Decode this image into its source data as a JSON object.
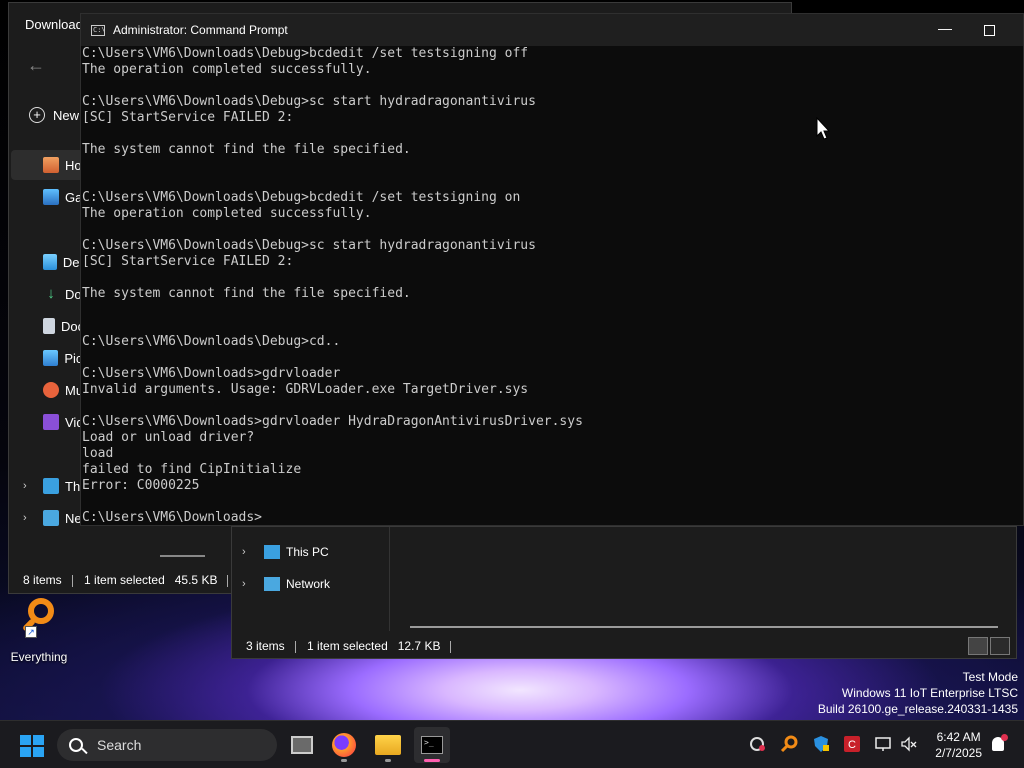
{
  "desktop": {
    "watermark": {
      "line1": "Test Mode",
      "line2": "Windows 11 IoT Enterprise LTSC",
      "line3": "Build 26100.ge_release.240331-1435"
    },
    "icons": [
      {
        "label": "Everything",
        "icon": "everything-search-icon"
      }
    ]
  },
  "explorer_back": {
    "tab_title": "Download",
    "new_label": "New",
    "nav_items": [
      {
        "label": "Ho",
        "icon": "home-icon"
      },
      {
        "label": "Gal",
        "icon": "gallery-icon"
      },
      {
        "label": "Des",
        "icon": "desktop-icon"
      },
      {
        "label": "Do",
        "icon": "downloads-icon"
      },
      {
        "label": "Doc",
        "icon": "documents-icon"
      },
      {
        "label": "Pict",
        "icon": "pictures-icon"
      },
      {
        "label": "Mu",
        "icon": "music-icon"
      },
      {
        "label": "Vid",
        "icon": "videos-icon"
      },
      {
        "label": "Thi",
        "icon": "this-pc-icon"
      },
      {
        "label": "Ne",
        "icon": "network-icon"
      }
    ],
    "status": {
      "items": "8 items",
      "selected": "1 item selected",
      "size": "45.5 KB"
    }
  },
  "explorer_front": {
    "nav_items": [
      {
        "label": "This PC",
        "icon": "this-pc-icon"
      },
      {
        "label": "Network",
        "icon": "network-icon"
      }
    ],
    "status": {
      "items": "3 items",
      "selected": "1 item selected",
      "size": "12.7 KB"
    }
  },
  "cmd": {
    "title": "Administrator: Command Prompt",
    "lines": [
      "C:\\Users\\VM6\\Downloads\\Debug>bcdedit /set testsigning off",
      "The operation completed successfully.",
      "",
      "C:\\Users\\VM6\\Downloads\\Debug>sc start hydradragonantivirus",
      "[SC] StartService FAILED 2:",
      "",
      "The system cannot find the file specified.",
      "",
      "",
      "C:\\Users\\VM6\\Downloads\\Debug>bcdedit /set testsigning on",
      "The operation completed successfully.",
      "",
      "C:\\Users\\VM6\\Downloads\\Debug>sc start hydradragonantivirus",
      "[SC] StartService FAILED 2:",
      "",
      "The system cannot find the file specified.",
      "",
      "",
      "C:\\Users\\VM6\\Downloads\\Debug>cd..",
      "",
      "C:\\Users\\VM6\\Downloads>gdrvloader",
      "Invalid arguments. Usage: GDRVLoader.exe TargetDriver.sys",
      "",
      "C:\\Users\\VM6\\Downloads>gdrvloader HydraDragonAntivirusDriver.sys",
      "Load or unload driver?",
      "load",
      "failed to find CipInitialize",
      "Error: C0000225",
      "",
      "C:\\Users\\VM6\\Downloads>"
    ]
  },
  "taskbar": {
    "search_placeholder": "Search",
    "apps": [
      {
        "icon": "task-view-icon"
      },
      {
        "icon": "firefox-icon"
      },
      {
        "icon": "file-explorer-icon"
      },
      {
        "icon": "terminal-icon"
      }
    ],
    "tray": [
      {
        "icon": "sync-icon"
      },
      {
        "icon": "everything-tray-icon"
      },
      {
        "icon": "defender-icon"
      },
      {
        "icon": "antivirus-icon"
      },
      {
        "icon": "network-icon"
      },
      {
        "icon": "volume-mute-icon"
      }
    ],
    "time": "6:42 AM",
    "date": "2/7/2025"
  },
  "colors": {
    "console_bg": "#0c0c0c",
    "console_text": "#cccccc",
    "start_blue": "#2aa4f4",
    "everything_orange": "#f28b16"
  }
}
